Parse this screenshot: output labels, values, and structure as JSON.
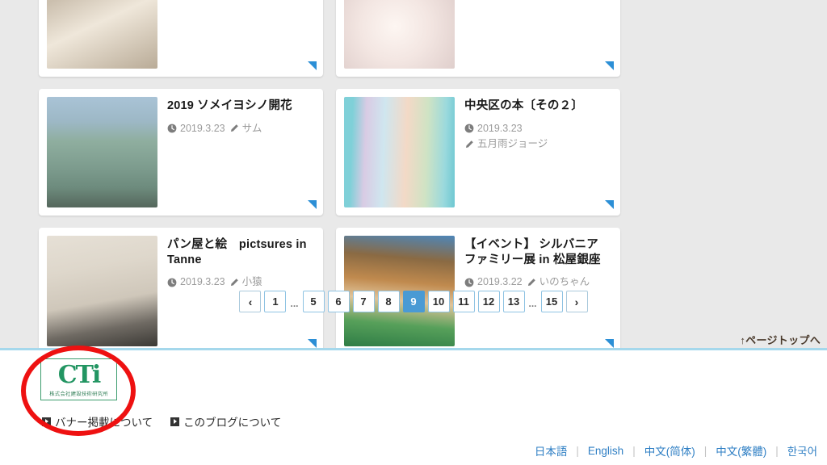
{
  "posts_top_partial": [
    {
      "id": "partial-left",
      "corner": true
    },
    {
      "id": "partial-right",
      "corner": true
    }
  ],
  "posts": [
    {
      "title": "2019 ソメイヨシノ開花",
      "date": "2019.3.23",
      "author": "サム",
      "thumb_alt": "桜の枝と日本橋の石柱"
    },
    {
      "title": "中央区の本〔その２〕",
      "date": "2019.3.23",
      "author": "五月雨ジョージ",
      "thumb_alt": "和綴じの冊子４冊"
    },
    {
      "title": "パン屋と絵　pictsures in Tanne",
      "date": "2019.3.23",
      "author": "小猿",
      "thumb_alt": "窓辺のカフェ店内"
    },
    {
      "title": "【イベント】 シルバニアファミリー展 in 松屋銀座",
      "date": "2019.3.22",
      "author": "いのちゃん",
      "thumb_alt": "シルバニアファミリーのジオラマ"
    }
  ],
  "pagination": {
    "prev_label": "‹",
    "next_label": "›",
    "gap_label": "...",
    "current": "9",
    "items": [
      {
        "type": "arrow",
        "label": "‹"
      },
      {
        "type": "page",
        "label": "1"
      },
      {
        "type": "gap",
        "label": "..."
      },
      {
        "type": "page",
        "label": "5"
      },
      {
        "type": "page",
        "label": "6"
      },
      {
        "type": "page",
        "label": "7"
      },
      {
        "type": "page",
        "label": "8"
      },
      {
        "type": "current",
        "label": "9"
      },
      {
        "type": "page",
        "label": "10"
      },
      {
        "type": "page",
        "label": "11"
      },
      {
        "type": "page",
        "label": "12"
      },
      {
        "type": "page",
        "label": "13"
      },
      {
        "type": "gap",
        "label": "..."
      },
      {
        "type": "page",
        "label": "15"
      },
      {
        "type": "arrow",
        "label": "›"
      }
    ]
  },
  "page_top": {
    "label": "↑ページトップへ"
  },
  "footer": {
    "logo": {
      "mark": "CTi",
      "sub": "株式会社建設技術研究所"
    },
    "links": [
      {
        "label": "バナー掲載について"
      },
      {
        "label": "このブログについて"
      }
    ],
    "languages": [
      {
        "label": "日本語"
      },
      {
        "label": "English"
      },
      {
        "label": "中文(简体)"
      },
      {
        "label": "中文(繁體)"
      },
      {
        "label": "한국어"
      }
    ],
    "lang_separator": "|"
  },
  "colors": {
    "page_bg": "#e9e9e9",
    "card_bg": "#ffffff",
    "accent_blue": "#4a9ad4",
    "corner_blue": "#2c8fd6",
    "divider_blue": "#a5d8ec",
    "logo_green": "#229562",
    "link_blue": "#2f7fc4",
    "pagetop_text": "#4a3a2c",
    "annotation_red": "#ee1111"
  },
  "annotation": {
    "shape": "ellipse",
    "target": "footer-logo"
  }
}
